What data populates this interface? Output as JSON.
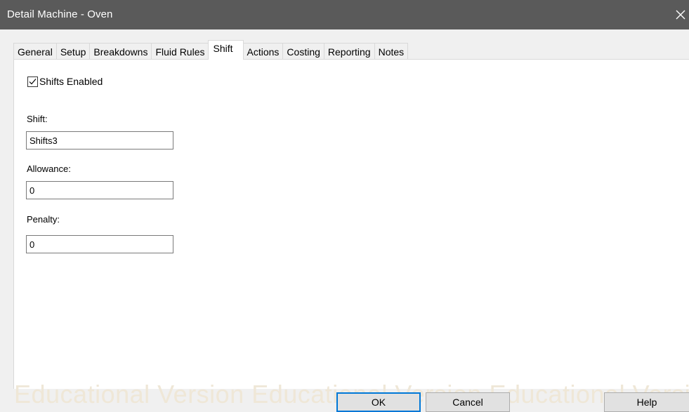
{
  "window": {
    "title": "Detail Machine - Oven",
    "close_icon": "close-icon"
  },
  "tabs": [
    {
      "label": "General"
    },
    {
      "label": "Setup"
    },
    {
      "label": "Breakdowns"
    },
    {
      "label": "Fluid Rules"
    },
    {
      "label": "Shift",
      "active": true
    },
    {
      "label": "Actions"
    },
    {
      "label": "Costing"
    },
    {
      "label": "Reporting"
    },
    {
      "label": "Notes"
    }
  ],
  "shift_panel": {
    "shifts_enabled": {
      "label": "Shifts Enabled",
      "checked": true
    },
    "shift": {
      "label": "Shift:",
      "value": "Shifts3"
    },
    "allowance": {
      "label": "Allowance:",
      "value": "0"
    },
    "penalty": {
      "label": "Penalty:",
      "value": "0"
    }
  },
  "watermark": "Educational Version Educational Version Educational Version",
  "buttons": {
    "ok": "OK",
    "cancel": "Cancel",
    "help": "Help"
  },
  "colors": {
    "titlebar": "#5a5a5a",
    "accent": "#0078d7"
  }
}
